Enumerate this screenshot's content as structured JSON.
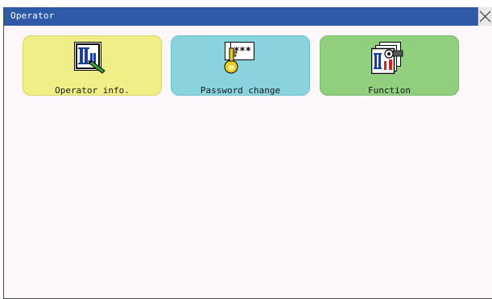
{
  "window": {
    "title": "Operator"
  },
  "tiles": [
    {
      "label": "Operator info.",
      "icon": "operator-info-icon",
      "color": "#f0ef86"
    },
    {
      "label": "Password change",
      "icon": "key-password-icon",
      "color": "#88d3de",
      "icon_text": "***"
    },
    {
      "label": "Function",
      "icon": "function-icon",
      "color": "#8fcf7e"
    }
  ],
  "colors": {
    "titlebar": "#2f5aa7",
    "background": "#fcf7fb"
  }
}
